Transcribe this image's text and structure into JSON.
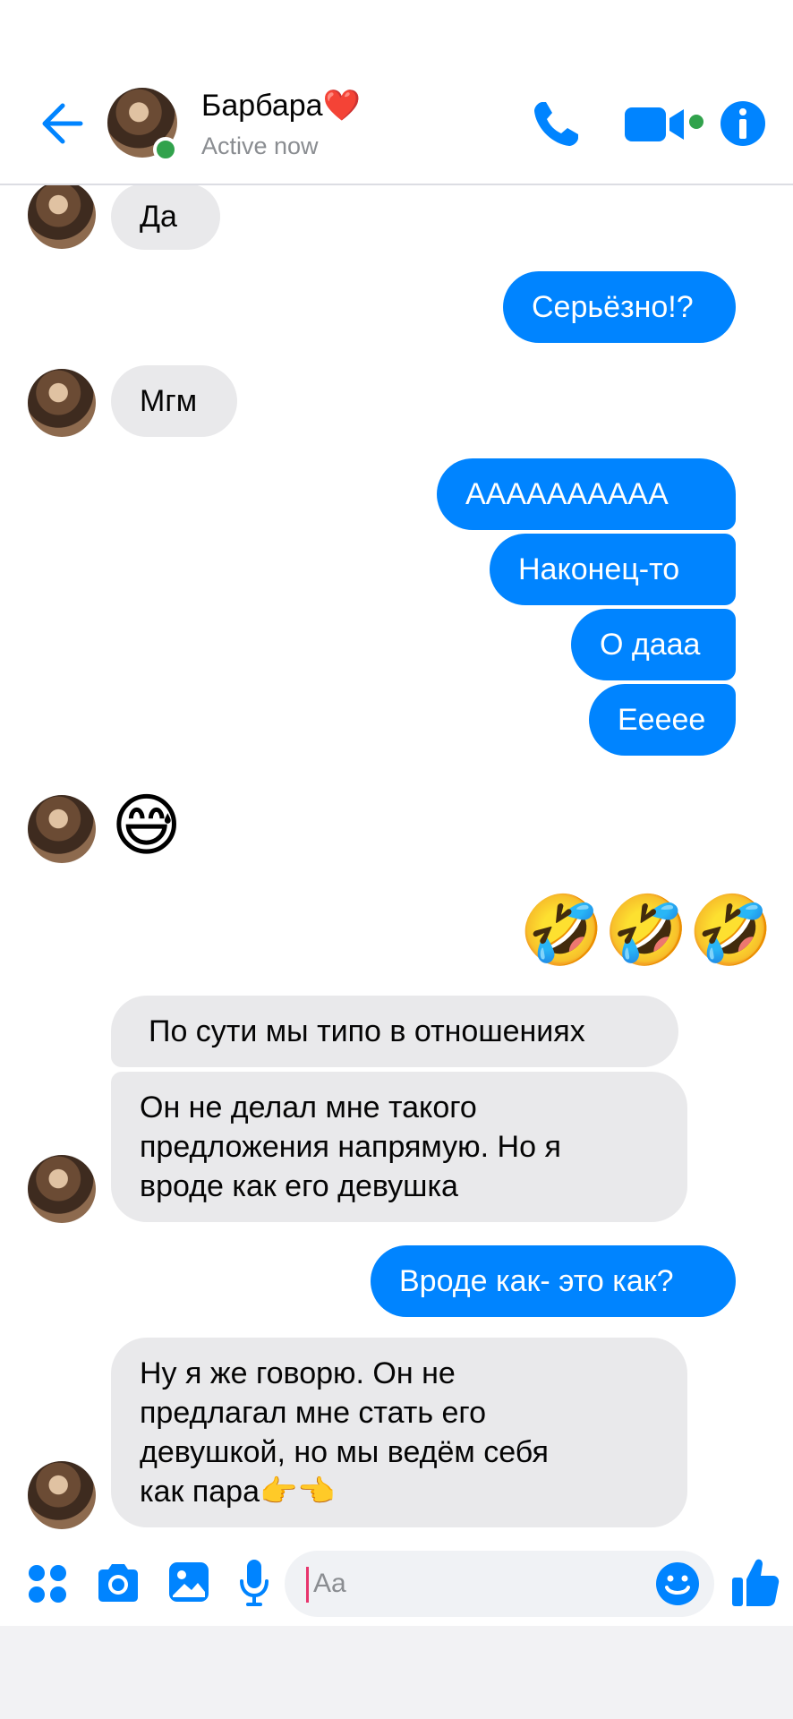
{
  "header": {
    "contact_name": "Барбара❤️",
    "status": "Active now",
    "colors": {
      "accent": "#0084ff",
      "online": "#31a24c"
    },
    "icons": [
      "back-arrow-icon",
      "phone-icon",
      "video-camera-icon",
      "info-icon"
    ]
  },
  "messages": [
    {
      "dir": "in",
      "text": "Да"
    },
    {
      "dir": "out",
      "text": "Серьёзно!?"
    },
    {
      "dir": "in",
      "text": "Мгм"
    },
    {
      "dir": "out",
      "text": "АААААААААА"
    },
    {
      "dir": "out",
      "text": "Наконец-то"
    },
    {
      "dir": "out",
      "text": "О дааа"
    },
    {
      "dir": "out",
      "text": "Ееееe"
    },
    {
      "dir": "in",
      "text": "😅"
    },
    {
      "dir": "out",
      "text": "🤣🤣🤣"
    },
    {
      "dir": "in",
      "text": "По сути мы типо в отношениях"
    },
    {
      "dir": "in",
      "lines": [
        "Он не делал мне такого",
        "предложения напрямую. Но я",
        "вроде как его девушка"
      ]
    },
    {
      "dir": "out",
      "text": "Вроде как- это как?"
    },
    {
      "dir": "in",
      "lines": [
        "Ну я же говорю. Он не",
        "предлагал мне стать его",
        "девушкой, но мы ведём себя",
        "как пара👉👈"
      ]
    }
  ],
  "composer": {
    "placeholder": "Aa",
    "icons": [
      "apps-grid-icon",
      "camera-icon",
      "gallery-icon",
      "microphone-icon",
      "emoji-smile-icon",
      "thumbs-up-icon"
    ]
  }
}
